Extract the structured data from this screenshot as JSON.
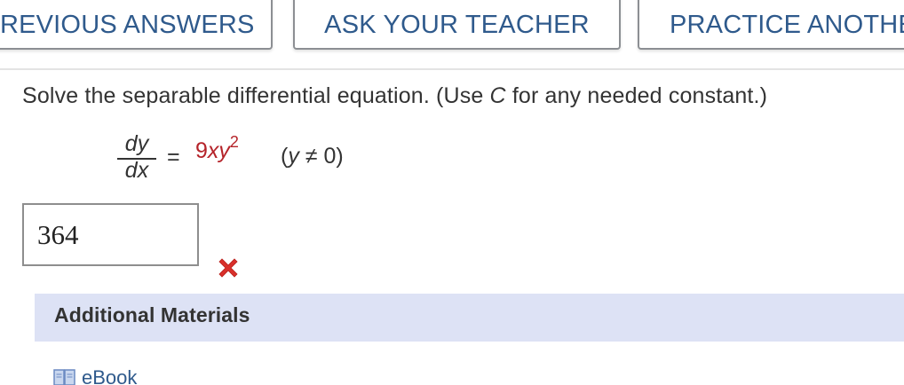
{
  "toolbar": {
    "previous_answers_label": "PREVIOUS ANSWERS",
    "ask_teacher_label": "ASK YOUR TEACHER",
    "practice_another_label": "PRACTICE ANOTHER"
  },
  "question": {
    "prefix": "Solve the separable differential equation. (Use ",
    "constant_var": "C",
    "suffix": " for any needed constant.)",
    "equation": {
      "numerator": "dy",
      "denominator": "dx",
      "equals": "=",
      "rhs_coef": "9",
      "rhs_vars": "xy",
      "rhs_exp": "2",
      "condition_open": "(",
      "condition_var": "y",
      "condition_rest": " ≠ 0)"
    }
  },
  "answer": {
    "value": "364",
    "status": "incorrect",
    "status_icon": "x-mark-icon",
    "status_color": "#d9302b"
  },
  "materials": {
    "title": "Additional Materials",
    "items": [
      {
        "label": "eBook",
        "icon": "book-icon"
      }
    ],
    "background": "#dde2f5"
  },
  "colors": {
    "link": "#2f5a8c",
    "equation_highlight": "#b5242a"
  }
}
